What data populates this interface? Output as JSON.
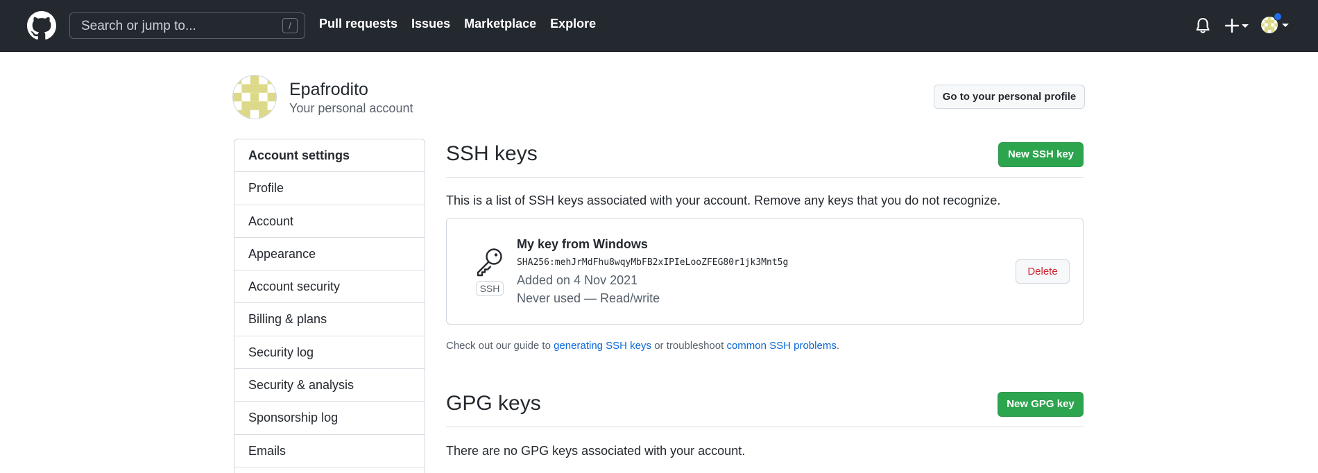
{
  "header": {
    "search_placeholder": "Search or jump to...",
    "search_shortcut": "/",
    "nav": [
      "Pull requests",
      "Issues",
      "Marketplace",
      "Explore"
    ],
    "bg_color": "#24292f"
  },
  "profile": {
    "name": "Epafrodito",
    "subtitle": "Your personal account",
    "go_profile_button": "Go to your personal profile"
  },
  "sidebar": {
    "items": [
      {
        "label": "Account settings"
      },
      {
        "label": "Profile"
      },
      {
        "label": "Account"
      },
      {
        "label": "Appearance"
      },
      {
        "label": "Account security"
      },
      {
        "label": "Billing & plans"
      },
      {
        "label": "Security log"
      },
      {
        "label": "Security & analysis"
      },
      {
        "label": "Sponsorship log"
      },
      {
        "label": "Emails"
      }
    ]
  },
  "ssh": {
    "title": "SSH keys",
    "new_button": "New SSH key",
    "description": "This is a list of SSH keys associated with your account. Remove any keys that you do not recognize.",
    "key": {
      "badge": "SSH",
      "name": "My key from Windows",
      "fingerprint": "SHA256:mehJrMdFhu8wqyMbFB2xIPIeLooZFEG80r1jk3Mnt5g",
      "added": "Added on 4 Nov 2021",
      "usage": "Never used — Read/write",
      "delete_button": "Delete"
    },
    "guide": {
      "prefix": "Check out our guide to ",
      "link1": "generating SSH keys",
      "middle": " or troubleshoot ",
      "link2": "common SSH problems",
      "suffix": "."
    }
  },
  "gpg": {
    "title": "GPG keys",
    "new_button": "New GPG key",
    "description": "There are no GPG keys associated with your account."
  },
  "colors": {
    "green": "#2da44e",
    "link": "#0969da",
    "danger": "#cf222e",
    "notification_dot": "#1f6feb"
  },
  "icons": [
    "github-logo-icon",
    "bell-icon",
    "plus-icon",
    "chevron-down-icon",
    "key-icon"
  ]
}
